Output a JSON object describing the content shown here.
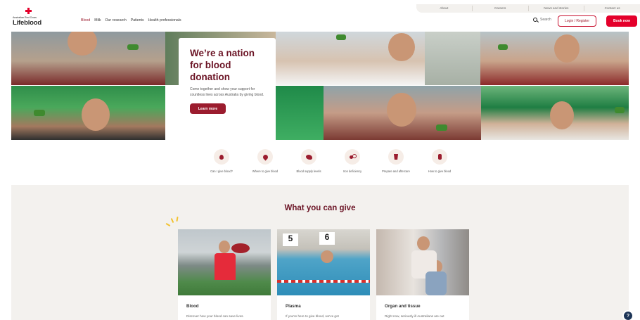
{
  "utility_nav": [
    "About",
    "Careers",
    "News and stories",
    "Contact us"
  ],
  "logo": {
    "sub": "Australian Red Cross",
    "main": "Lifeblood"
  },
  "main_nav": [
    {
      "label": "Blood"
    },
    {
      "label": "Milk"
    },
    {
      "label": "Our research"
    },
    {
      "label": "Patients"
    },
    {
      "label": "Health professionals"
    }
  ],
  "header": {
    "search_label": "Search",
    "login_label": "Login / Register",
    "book_label": "Book now"
  },
  "hero": {
    "title": "We’re a nation for blood donation",
    "description": "Come together and show your support for countless lives across Australia by giving blood.",
    "cta": "Learn more"
  },
  "quick_links": [
    {
      "label": "Can I give blood?",
      "icon": "blood-drop-icon"
    },
    {
      "label": "Where to give blood",
      "icon": "location-pin-icon"
    },
    {
      "label": "Blood supply levels",
      "icon": "australia-map-icon"
    },
    {
      "label": "Iron deficiency",
      "icon": "iron-icon"
    },
    {
      "label": "Prepare and aftercare",
      "icon": "cup-icon"
    },
    {
      "label": "How to give blood",
      "icon": "blood-bag-icon"
    }
  ],
  "give_section": {
    "title": "What you can give",
    "cards": [
      {
        "title": "Blood",
        "description": "Discover how your blood can save lives."
      },
      {
        "title": "Plasma",
        "description": "If you're here to give blood, we've got"
      },
      {
        "title": "Organ and tissue",
        "description": "Right now, seriously ill Australians are out"
      }
    ]
  },
  "help": {
    "label": "?"
  },
  "colors": {
    "brand_red": "#e4002b",
    "brand_maroon": "#9b1c2e",
    "heading": "#6b1425",
    "section_bg": "#f3f1ee"
  }
}
